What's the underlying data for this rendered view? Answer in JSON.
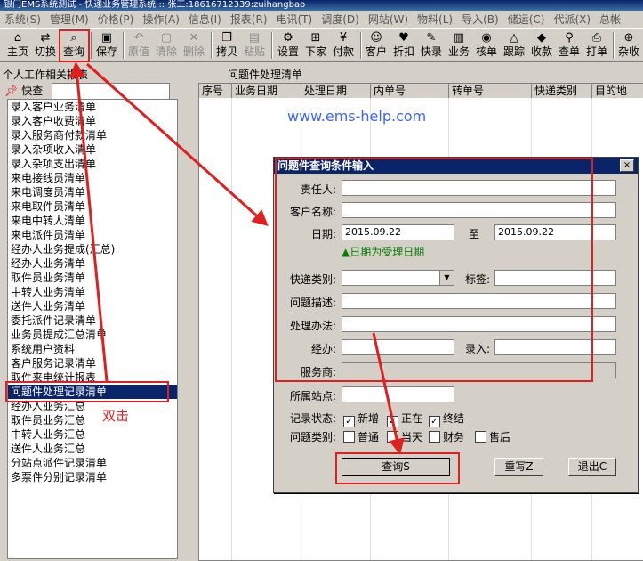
{
  "window": {
    "title": "银门EMS系统测试 - 快递业务管理系统 :: 张工:18616712339:zuihangbao"
  },
  "menu": [
    "系统(S)",
    "管理(M)",
    "价格(P)",
    "操作(A)",
    "信息(I)",
    "报表(R)",
    "电讯(T)",
    "调度(D)",
    "网站(W)",
    "物料(L)",
    "导入(B)",
    "储运(C)",
    "代派(X)",
    "总帐"
  ],
  "toolbar": [
    {
      "label": "主页",
      "icon": "home-icon",
      "glyph": "⌂"
    },
    {
      "label": "切换",
      "icon": "switch-icon",
      "glyph": "⇄"
    },
    {
      "label": "查询",
      "icon": "binoculars-icon",
      "glyph": "⌕"
    },
    {
      "label": "保存",
      "icon": "floppy-icon",
      "glyph": "▣"
    },
    {
      "label": "原值",
      "icon": "restore-icon",
      "glyph": "↶"
    },
    {
      "label": "清除",
      "icon": "clear-icon",
      "glyph": "▢"
    },
    {
      "label": "删除",
      "icon": "delete-icon",
      "glyph": "✕"
    },
    {
      "label": "拷贝",
      "icon": "copy-icon",
      "glyph": "❐"
    },
    {
      "label": "粘贴",
      "icon": "paste-icon",
      "glyph": "▤"
    },
    {
      "label": "设置",
      "icon": "settings-icon",
      "glyph": "⚙"
    },
    {
      "label": "下家",
      "icon": "network-icon",
      "glyph": "⊞"
    },
    {
      "label": "付款",
      "icon": "payment-icon",
      "glyph": "¥"
    },
    {
      "label": "客户",
      "icon": "customers-icon",
      "glyph": "☺"
    },
    {
      "label": "折扣",
      "icon": "discount-icon",
      "glyph": "♥"
    },
    {
      "label": "快录",
      "icon": "quick-entry-icon",
      "glyph": "✎"
    },
    {
      "label": "业务",
      "icon": "business-icon",
      "glyph": "▥"
    },
    {
      "label": "核单",
      "icon": "check-order-icon",
      "glyph": "◉"
    },
    {
      "label": "跟踪",
      "icon": "tracking-icon",
      "glyph": "△"
    },
    {
      "label": "收款",
      "icon": "collection-icon",
      "glyph": "◆"
    },
    {
      "label": "查单",
      "icon": "search-order-icon",
      "glyph": "⚲"
    },
    {
      "label": "打单",
      "icon": "print-icon",
      "glyph": "⎙"
    },
    {
      "label": "杂收",
      "icon": "misc-income-icon",
      "glyph": "⊕"
    }
  ],
  "left_panel": {
    "title": "个人工作相关报表",
    "search_label": "快查",
    "search_value": "",
    "items": [
      "录入客户业务清单",
      "录入客户收费清单",
      "录入服务商付款清单",
      "录入杂项收入清单",
      "录入杂项支出清单",
      "来电接线员清单",
      "来电调度员清单",
      "来电取件员清单",
      "来电中转人清单",
      "来电派件员清单",
      "经办人业务提成(汇总)",
      "经办人业务清单",
      "取件员业务清单",
      "中转人业务清单",
      "送件人业务清单",
      "委托派件记录清单",
      "业务员提成汇总清单",
      "系统用户资料",
      "客户服务记录清单",
      "取件来电统计报表",
      "问题件处理记录清单",
      "经办人业务汇总",
      "取件员业务汇总",
      "中转人业务汇总",
      "送件人业务汇总",
      "分站点派件记录清单",
      "多票件分别记录清单"
    ],
    "selected_index": 20
  },
  "right_panel": {
    "title": "问题件处理清单",
    "columns": [
      "序号",
      "业务日期",
      "处理日期",
      "内单号",
      "转单号",
      "快递类别",
      "目的地"
    ]
  },
  "watermark": "www.ems-help.com",
  "annotation": {
    "double_click": "双击"
  },
  "dialog": {
    "title": "问题件查询条件输入",
    "close": "×",
    "responsible_label": "责任人:",
    "customer_label": "客户名称:",
    "date_label": "日期:",
    "date_from": "2015.09.22",
    "date_to_label": "至",
    "date_to": "2015.09.22",
    "date_note": "▲日期为受理日期",
    "express_type_label": "快递类别:",
    "tag_label": "标签:",
    "problem_desc_label": "问题描述:",
    "handle_method_label": "处理办法:",
    "handler_label": "经办:",
    "entry_label": "录入:",
    "provider_label": "服务商:",
    "site_label": "所属站点:",
    "record_status_label": "记录状态:",
    "status_options": [
      {
        "label": "新增",
        "checked": true
      },
      {
        "label": "正在",
        "checked": true
      },
      {
        "label": "终结",
        "checked": true
      }
    ],
    "problem_type_label": "问题类别:",
    "type_options": [
      {
        "label": "普通",
        "checked": false
      },
      {
        "label": "当天",
        "checked": false
      },
      {
        "label": "财务",
        "checked": false
      },
      {
        "label": "售后",
        "checked": false
      }
    ],
    "query_button": "查询S",
    "reset_button": "重写Z",
    "exit_button": "退出C"
  },
  "colors": {
    "highlight": "#e02020",
    "selection": "#0a246a",
    "watermark": "#3b64ff",
    "note": "#0a7a0a"
  }
}
